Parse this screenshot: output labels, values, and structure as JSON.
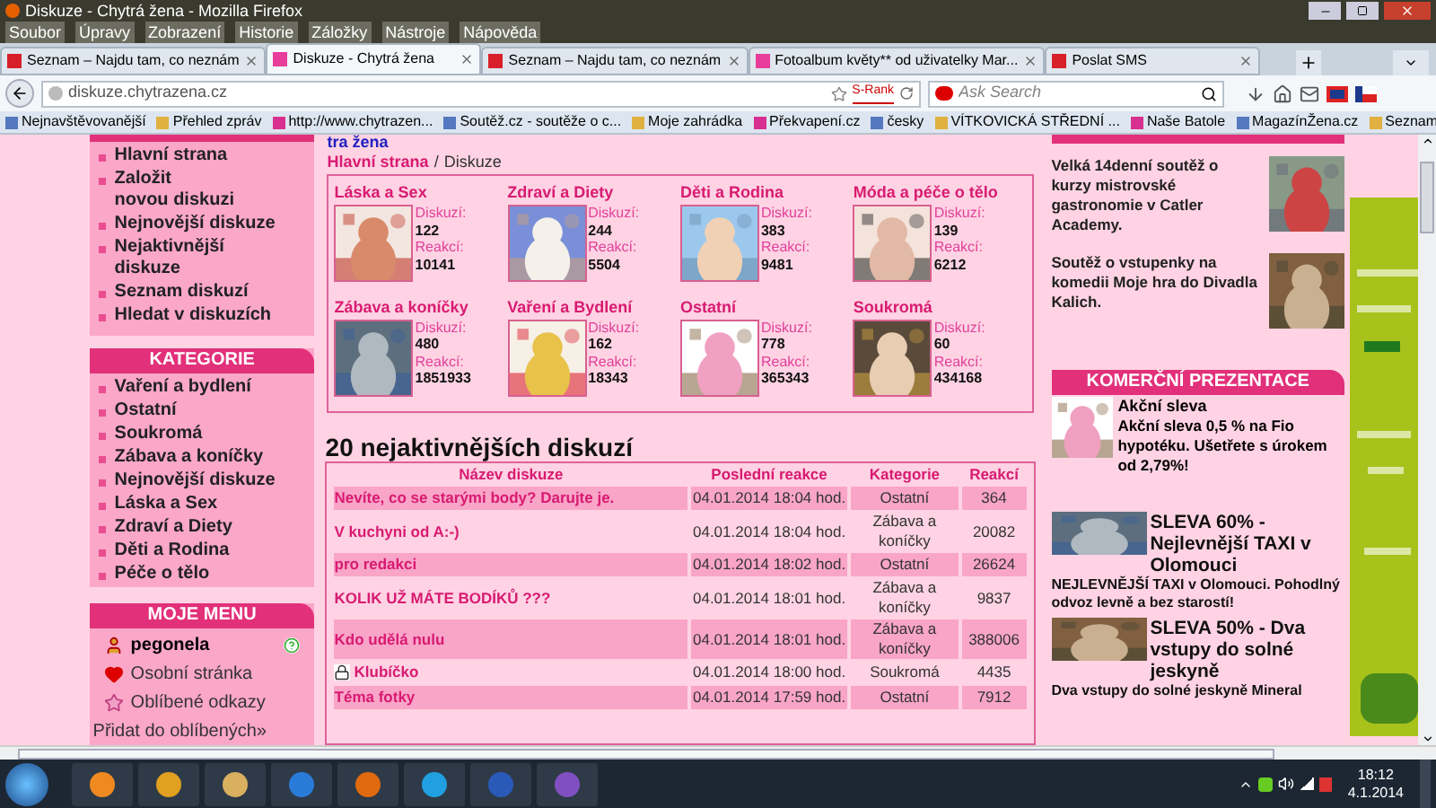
{
  "window": {
    "title": "Diskuze - Chytrá žena - Mozilla Firefox"
  },
  "menu": [
    "Soubor",
    "Úpravy",
    "Zobrazení",
    "Historie",
    "Záložky",
    "Nástroje",
    "Nápověda"
  ],
  "tabs": [
    {
      "label": "Seznam – Najdu tam, co neznám",
      "selected": false
    },
    {
      "label": "Diskuze - Chytrá žena",
      "selected": true
    },
    {
      "label": "Seznam – Najdu tam, co neznám",
      "selected": false
    },
    {
      "label": "Fotoalbum květy** od uživatelky Mar...",
      "selected": false
    },
    {
      "label": "Poslat SMS",
      "selected": false
    }
  ],
  "address": {
    "url": "diskuze.chytrazena.cz",
    "rank": "S-Rank"
  },
  "search": {
    "placeholder": "Ask Search"
  },
  "bookmarks": [
    "Nejnavštěvovanější",
    "Přehled zpráv",
    "http://www.chytrazen...",
    "Soutěž.cz - soutěže o c...",
    "Moje zahrádka",
    "Překvapení.cz",
    "česky",
    "VÍTKOVICKÁ STŘEDNÍ ...",
    "Naše Batole",
    "MagazínŽena.cz",
    "Seznam"
  ],
  "sidebar": {
    "main_items": [
      {
        "lines": [
          "Hlavní strana"
        ]
      },
      {
        "lines": [
          "Založit",
          "novou diskuzi"
        ]
      },
      {
        "lines": [
          "Nejnovější diskuze"
        ]
      },
      {
        "lines": [
          "Nejaktivnější",
          "diskuze"
        ]
      },
      {
        "lines": [
          "Seznam diskuzí"
        ]
      },
      {
        "lines": [
          "Hledat v diskuzích"
        ]
      }
    ],
    "categories_title": "KATEGORIE",
    "categories": [
      "Vaření a bydlení",
      "Ostatní",
      "Soukromá",
      "Zábava a koníčky",
      "Nejnovější diskuze",
      "Láska a Sex",
      "Zdraví a Diety",
      "Děti a Rodina",
      "Péče o tělo"
    ],
    "my_menu_title": "MOJE MENU",
    "user": "pegonela",
    "personal_page": "Osobní stránka",
    "favorites": "Oblíbené odkazy",
    "add_favorite": "Přidat do oblíbených»"
  },
  "site_heading": "tra žena",
  "breadcrumb": {
    "home": "Hlavní strana",
    "separator": "/",
    "current": "Diskuze"
  },
  "category_tiles": [
    {
      "title": "Láska a Sex",
      "discussions_label": "Diskuzí:",
      "discussions": "122",
      "reactions_label": "Reakcí:",
      "reactions": "10141"
    },
    {
      "title": "Zdraví a Diety",
      "discussions_label": "Diskuzí:",
      "discussions": "244",
      "reactions_label": "Reakcí:",
      "reactions": "5504"
    },
    {
      "title": "Děti a Rodina",
      "discussions_label": "Diskuzí:",
      "discussions": "383",
      "reactions_label": "Reakcí:",
      "reactions": "9481"
    },
    {
      "title": "Móda a péče o tělo",
      "discussions_label": "Diskuzí:",
      "discussions": "139",
      "reactions_label": "Reakcí:",
      "reactions": "6212"
    },
    {
      "title": "Zábava a koníčky",
      "discussions_label": "Diskuzí:",
      "discussions": "480",
      "reactions_label": "Reakcí:",
      "reactions": "1851933"
    },
    {
      "title": "Vaření a Bydlení",
      "discussions_label": "Diskuzí:",
      "discussions": "162",
      "reactions_label": "Reakcí:",
      "reactions": "18343"
    },
    {
      "title": "Ostatní",
      "discussions_label": "Diskuzí:",
      "discussions": "778",
      "reactions_label": "Reakcí:",
      "reactions": "365343"
    },
    {
      "title": "Soukromá",
      "discussions_label": "Diskuzí:",
      "discussions": "60",
      "reactions_label": "Reakcí:",
      "reactions": "434168"
    }
  ],
  "table_heading": "20 nejaktivnějších diskuzí",
  "table": {
    "columns": [
      "Název diskuze",
      "Poslední reakce",
      "Kategorie",
      "Reakcí"
    ],
    "rows": [
      {
        "name": "Nevíte, co se starými body? Darujte je.",
        "last": "04.01.2014 18:04 hod.",
        "category": "Ostatní",
        "reactions": "364",
        "shaded": true,
        "locked": false
      },
      {
        "name": "V kuchyni od A:-)",
        "last": "04.01.2014 18:04 hod.",
        "category": "Zábava a koníčky",
        "reactions": "20082",
        "shaded": false,
        "locked": false
      },
      {
        "name": "pro redakci",
        "last": "04.01.2014 18:02 hod.",
        "category": "Ostatní",
        "reactions": "26624",
        "shaded": true,
        "locked": false
      },
      {
        "name": "KOLIK UŽ MÁTE BODÍKŮ ???",
        "last": "04.01.2014 18:01 hod.",
        "category": "Zábava a koníčky",
        "reactions": "9837",
        "shaded": false,
        "locked": false
      },
      {
        "name": "Kdo udělá nulu",
        "last": "04.01.2014 18:01 hod.",
        "category": "Zábava a koníčky",
        "reactions": "388006",
        "shaded": true,
        "locked": false
      },
      {
        "name": "Klubíčko",
        "last": "04.01.2014 18:00 hod.",
        "category": "Soukromá",
        "reactions": "4435",
        "shaded": false,
        "locked": true
      },
      {
        "name": "Téma fotky",
        "last": "04.01.2014 17:59 hod.",
        "category": "Ostatní",
        "reactions": "7912",
        "shaded": true,
        "locked": false
      }
    ]
  },
  "contests": [
    "Velká 14denní soutěž o kurzy mistrovské gastronomie v Catler Academy.",
    "Soutěž o vstupenky na komedii Moje hra do Divadla Kalich."
  ],
  "promo_title": "KOMERČNÍ PREZENTACE",
  "promo": {
    "title": "Akční sleva",
    "text": "Akční sleva 0,5 % na Fio hypotéku. Ušetřete s úrokem od 2,79%!"
  },
  "deals": [
    {
      "title": "SLEVA 60% - Nejlevnější TAXI v Olomouci",
      "text": "NEJLEVNĚJŠÍ TAXI v Olomouci. Pohodlný odvoz levně a bez starostí!"
    },
    {
      "title": "SLEVA 50% - Dva vstupy do solné jeskyně",
      "text": "Dva vstupy do solné jeskyně Mineral"
    }
  ],
  "clock": {
    "time": "18:12",
    "date": "4.1.2014"
  }
}
